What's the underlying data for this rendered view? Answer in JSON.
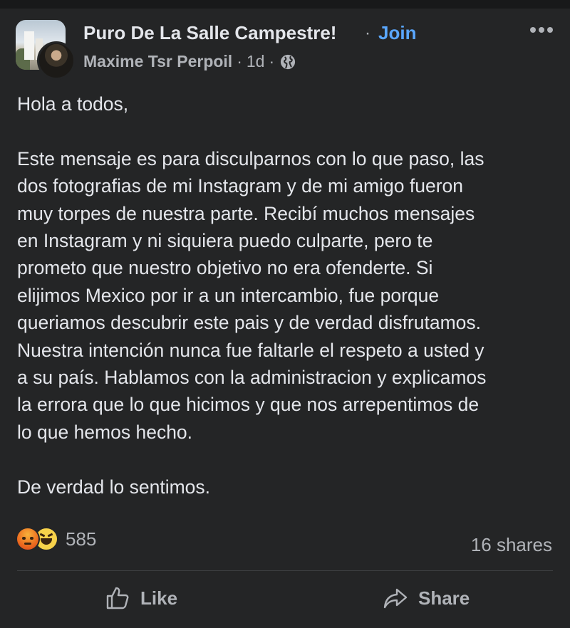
{
  "post": {
    "group_name": "Puro De La Salle Campestre!",
    "separator": "·",
    "join_label": "Join",
    "author": "Maxime Tsr Perpoil",
    "time": "1d",
    "privacy_icon": "globe-icon",
    "more_icon": "more-options-icon",
    "body_lines": [
      "Hola a todos,",
      "",
      "Este mensaje es para disculparnos con lo que paso, las",
      "dos fotografias de mi Instagram y de mi amigo fueron",
      "muy torpes de nuestra parte. Recibí muchos mensajes",
      "en Instagram y ni siquiera puedo culparte, pero te",
      "prometo que nuestro objetivo no era ofenderte. Si",
      "elijimos Mexico por ir a un intercambio, fue porque",
      "queriamos descubrir este pais y de verdad disfrutamos.",
      "Nuestra intención nunca fue faltarle el respeto a usted y",
      "a su país. Hablamos con la administracion y explicamos",
      "la errora que lo que hicimos y que nos arrepentimos de",
      "lo que hemos hecho.",
      "",
      "De verdad lo sentimos."
    ]
  },
  "stats": {
    "reaction_icons": [
      "angry-icon",
      "haha-icon"
    ],
    "reaction_count": "585",
    "shares": "16 shares"
  },
  "actions": {
    "like_label": "Like",
    "share_label": "Share"
  },
  "colors": {
    "background": "#242526",
    "text": "#e4e6eb",
    "secondary_text": "#b0b3b8",
    "link": "#5aa7ff"
  }
}
